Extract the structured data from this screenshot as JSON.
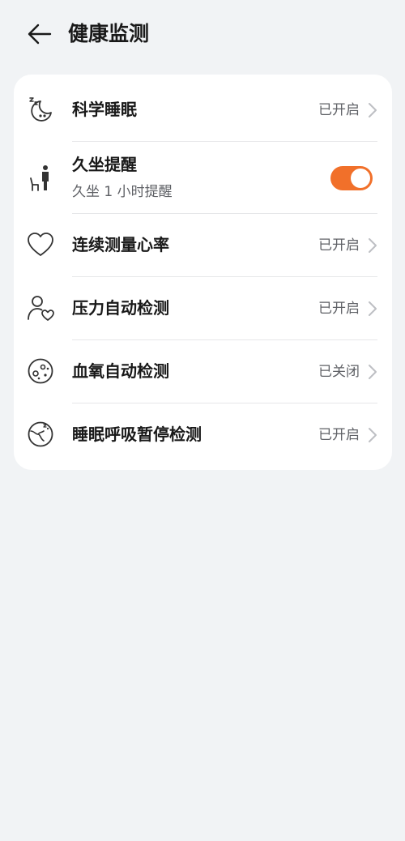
{
  "header": {
    "title": "健康监测",
    "back_icon": "arrow-left-icon"
  },
  "accent_color": "#f1702a",
  "items": [
    {
      "id": "sleep",
      "title": "科学睡眠",
      "status": "已开启",
      "icon": "sleep-moon-icon"
    },
    {
      "id": "sedentary",
      "title": "久坐提醒",
      "subtitle": "久坐 1 小时提醒",
      "toggle_on": true,
      "icon": "sedentary-person-icon"
    },
    {
      "id": "heart-rate",
      "title": "连续测量心率",
      "status": "已开启",
      "icon": "heart-icon"
    },
    {
      "id": "stress",
      "title": "压力自动检测",
      "status": "已开启",
      "icon": "person-heart-icon"
    },
    {
      "id": "spo2",
      "title": "血氧自动检测",
      "status": "已关闭",
      "icon": "blood-oxygen-icon"
    },
    {
      "id": "sleep-apnea",
      "title": "睡眠呼吸暂停检测",
      "status": "已开启",
      "icon": "sleep-apnea-icon"
    }
  ]
}
